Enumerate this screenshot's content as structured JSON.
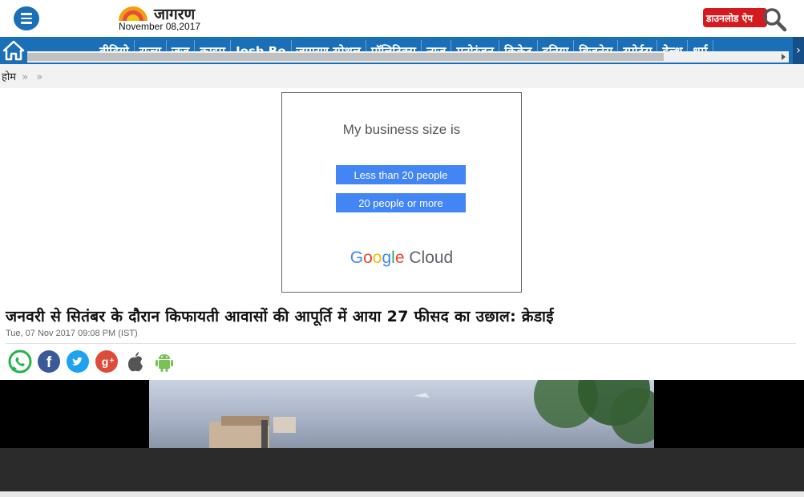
{
  "header": {
    "logo_text": "जागरण",
    "date": "November 08,2017",
    "download_label": "डाउनलोड ऐप"
  },
  "nav": {
    "items": [
      "वीडियो",
      "राज्य",
      "जज़",
      "क्राइम",
      "Josh Bo",
      "जागरण स्पेशल",
      "पॉलिटिक्स",
      "न्यूज़",
      "मनोरंजन",
      "क्रिकेट",
      "दुनिया",
      "बिज़नेस",
      "स्पोर्ट्स",
      "हेल्थ",
      "धर्म"
    ]
  },
  "breadcrumb": {
    "home": "होम",
    "sep1": "»",
    "sep2": "»"
  },
  "ad": {
    "title": "My business size is",
    "option1": "Less than 20 people",
    "option2": "20 people or more",
    "brand_word": "Cloud"
  },
  "article": {
    "headline": "जनवरी से सितंबर के दौरान किफायती आवासों की आपूर्ति में आया 27 फीसद का उछाल: क्रेडाई",
    "dateline": "Tue, 07 Nov 2017 09:08 PM (IST)"
  },
  "share": {
    "icons": [
      "whatsapp-icon",
      "facebook-icon",
      "twitter-icon",
      "google-plus-icon",
      "apple-icon",
      "android-icon"
    ]
  },
  "colors": {
    "nav_blue": "#1a6fb7",
    "download_red": "#d41a1f",
    "ad_button": "#4285f4"
  }
}
